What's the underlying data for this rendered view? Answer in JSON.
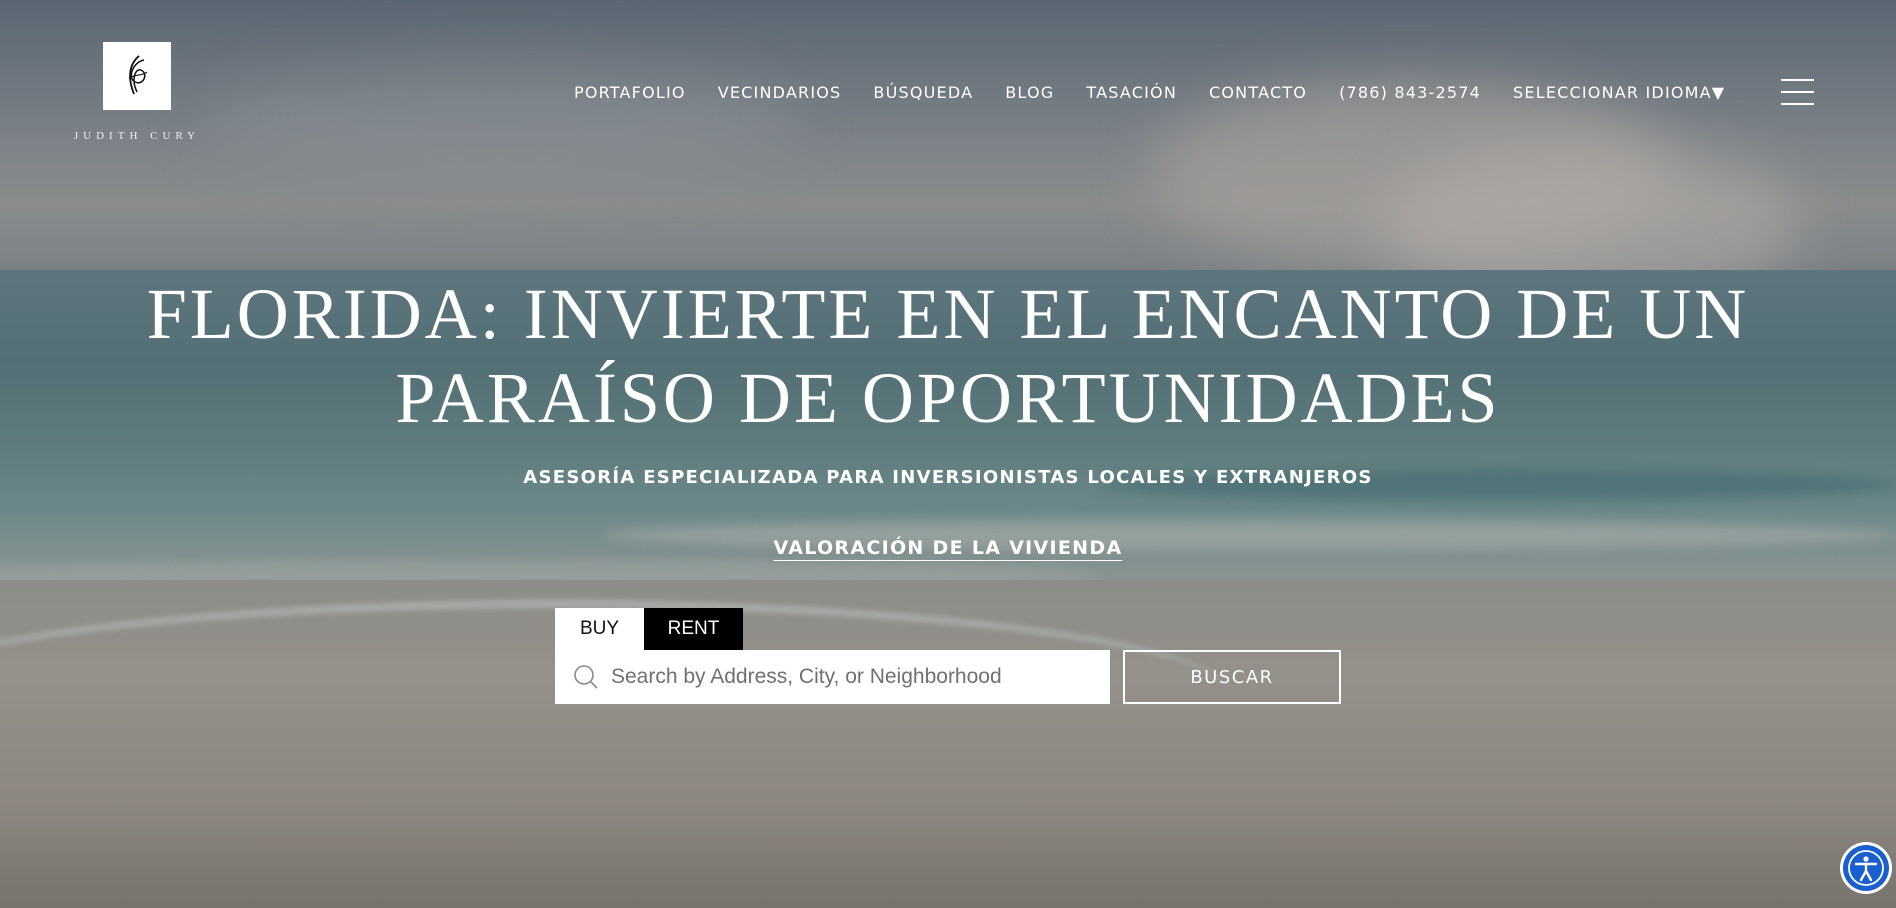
{
  "brand": {
    "name": "JUDITH CURY"
  },
  "nav": {
    "items": [
      "PORTAFOLIO",
      "VECINDARIOS",
      "BÚSQUEDA",
      "BLOG",
      "TASACIÓN",
      "CONTACTO",
      "(786) 843-2574"
    ],
    "language": "SELECCIONAR IDIOMA▼"
  },
  "hero": {
    "title_line1": "FLORIDA: INVIERTE EN EL ENCANTO DE UN",
    "title_line2": "PARAÍSO DE OPORTUNIDADES",
    "subtitle": "ASESORÍA ESPECIALIZADA PARA INVERSIONISTAS LOCALES Y EXTRANJEROS",
    "valuation_link": "VALORACIÓN DE LA VIVIENDA"
  },
  "search": {
    "tabs": [
      "BUY",
      "RENT"
    ],
    "placeholder": "Search by Address, City, or Neighborhood",
    "button": "BUSCAR"
  },
  "icons": {
    "logo": "signature-monogram-logo",
    "menu": "hamburger-menu-icon",
    "search": "search-icon",
    "accessibility": "accessibility-icon"
  },
  "colors": {
    "accessibility_button": "#1a5fd0",
    "rent_tab": "#000000",
    "buy_tab": "#ffffff"
  }
}
